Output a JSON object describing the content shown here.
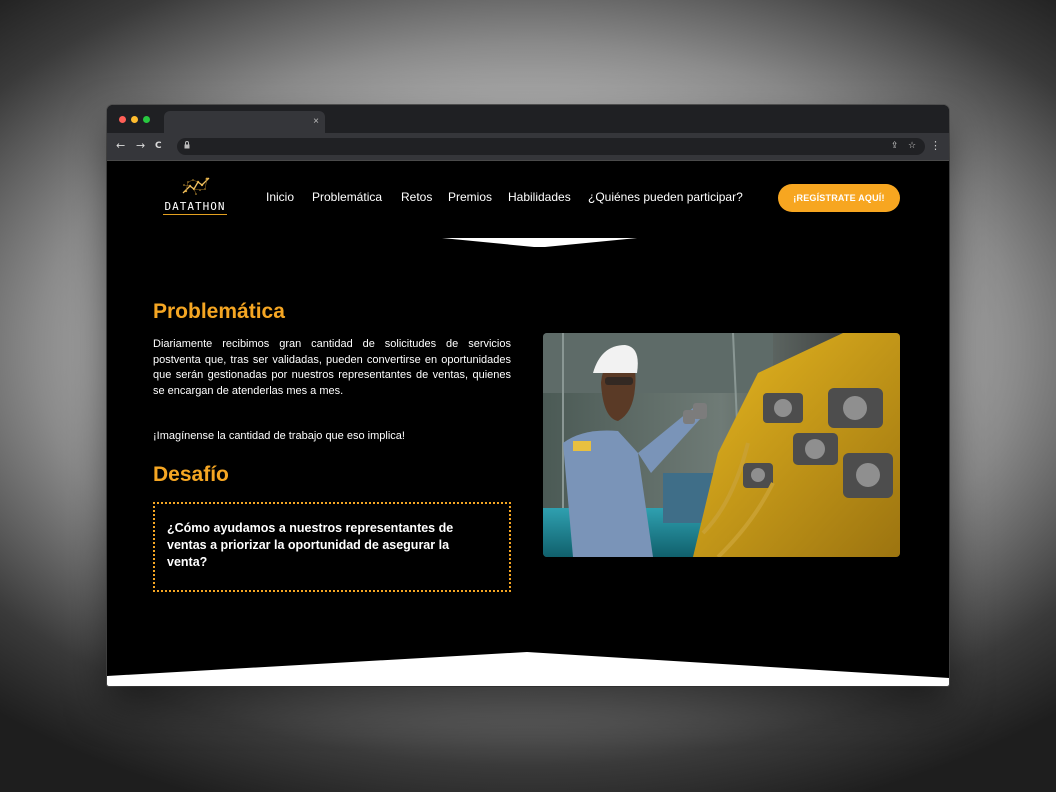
{
  "browser": {
    "tab_close_glyph": "×",
    "nav_back": "←",
    "nav_forward": "→",
    "nav_reload": "C",
    "lock_glyph": "🔒",
    "share_glyph": "⇪",
    "star_glyph": "☆",
    "menu_glyph": "⋮"
  },
  "site": {
    "logo_text": "DATATHON",
    "nav": [
      "Inicio",
      "Problemática",
      "Retos",
      "Premios",
      "Habilidades",
      "¿Quiénes pueden participar?"
    ],
    "cta_label": "¡REGÍSTRATE AQUÍ!"
  },
  "problem": {
    "title": "Problemática",
    "paragraph": "Diariamente recibimos gran cantidad de solicitudes de servicios postventa que, tras ser validadas, pueden convertirse en oportunidades que serán gestionadas por nuestros representantes de ventas, quienes se encargan de atenderlas mes a mes.",
    "exclamation": "¡Imagínense la cantidad de trabajo que eso implica!"
  },
  "challenge": {
    "title": "Desafío",
    "question": "¿Cómo ayudamos a nuestros representantes de ventas a priorizar la oportunidad de asegurar la venta?"
  },
  "colors": {
    "accent": "#f5a623",
    "cta": "#f7a620",
    "background": "#000000",
    "text": "#ffffff"
  },
  "icons": [
    "back-arrow-icon",
    "forward-arrow-icon",
    "reload-icon",
    "lock-icon",
    "share-icon",
    "star-icon",
    "menu-dots-icon",
    "close-icon",
    "logo-chart-icon"
  ]
}
